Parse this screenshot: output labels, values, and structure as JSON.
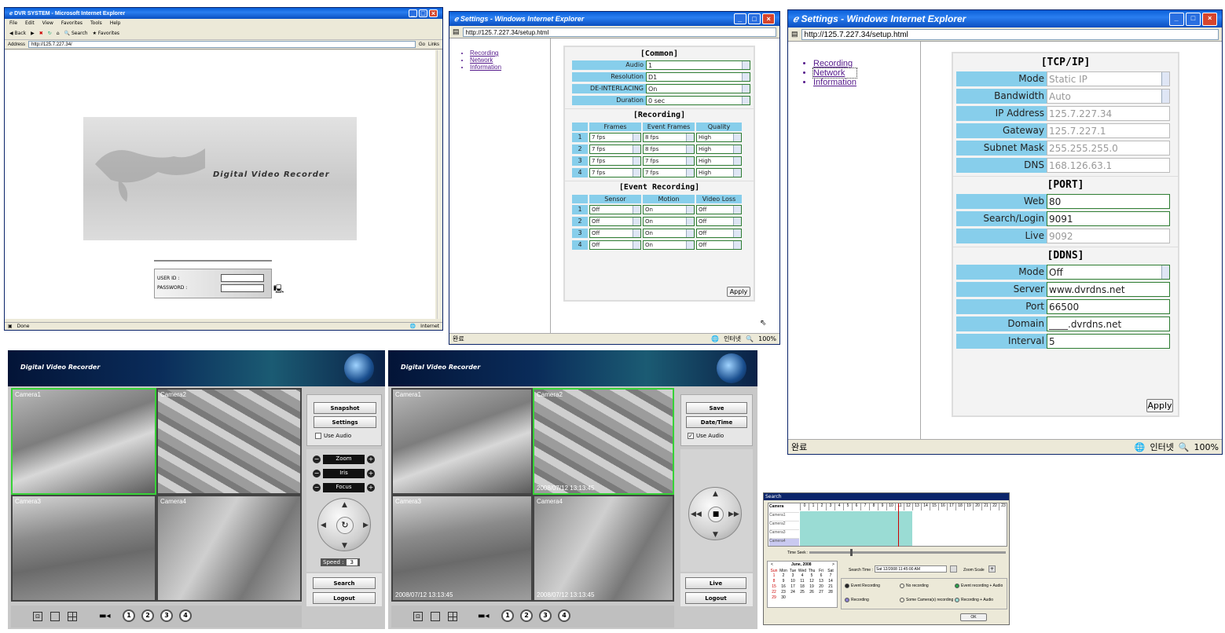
{
  "win1": {
    "title": "DVR SYSTEM - Microsoft Internet Explorer",
    "menu": [
      "File",
      "Edit",
      "View",
      "Favorites",
      "Tools",
      "Help"
    ],
    "toolbar": {
      "back": "Back",
      "search": "Search",
      "favorites": "Favorites"
    },
    "address_label": "Address",
    "url": "http://125.7.227.34/",
    "go": "Go",
    "links": "Links",
    "banner": "Digital Video Recorder",
    "user_id_label": "USER ID :",
    "password_label": "PASSWORD :",
    "status_left": "Done",
    "status_right": "Internet"
  },
  "win2": {
    "title": "Settings - Windows Internet Explorer",
    "url": "http://125.7.227.34/setup.html",
    "nav": [
      "Recording",
      "Network",
      "Information"
    ],
    "common_title": "[Common]",
    "common": [
      {
        "label": "Audio",
        "value": "1"
      },
      {
        "label": "Resolution",
        "value": "D1"
      },
      {
        "label": "DE-INTERLACING",
        "value": "On"
      },
      {
        "label": "Duration",
        "value": "0 sec"
      }
    ],
    "recording_title": "[Recording]",
    "rec_headers": [
      "Frames",
      "Event Frames",
      "Quality"
    ],
    "rec_rows": [
      {
        "n": "1",
        "frames": "7 fps",
        "event": "8 fps",
        "quality": "High"
      },
      {
        "n": "2",
        "frames": "7 fps",
        "event": "8 fps",
        "quality": "High"
      },
      {
        "n": "3",
        "frames": "7 fps",
        "event": "7 fps",
        "quality": "High"
      },
      {
        "n": "4",
        "frames": "7 fps",
        "event": "7 fps",
        "quality": "High"
      }
    ],
    "event_title": "[Event Recording]",
    "ev_headers": [
      "Sensor",
      "Motion",
      "Video Loss"
    ],
    "ev_rows": [
      {
        "n": "1",
        "sensor": "Off",
        "motion": "On",
        "loss": "Off"
      },
      {
        "n": "2",
        "sensor": "Off",
        "motion": "On",
        "loss": "Off"
      },
      {
        "n": "3",
        "sensor": "Off",
        "motion": "On",
        "loss": "Off"
      },
      {
        "n": "4",
        "sensor": "Off",
        "motion": "On",
        "loss": "Off"
      }
    ],
    "apply": "Apply",
    "status_left": "완료",
    "status_zone": "인터넷",
    "zoom": "100%"
  },
  "win3": {
    "title": "Settings - Windows Internet Explorer",
    "url": "http://125.7.227.34/setup.html",
    "nav": [
      "Recording",
      "Network",
      "Information"
    ],
    "tcp_title": "[TCP/IP]",
    "tcp": [
      {
        "label": "Mode",
        "value": "Static IP",
        "type": "select",
        "disabled": true
      },
      {
        "label": "Bandwidth",
        "value": "Auto",
        "type": "select",
        "disabled": true
      },
      {
        "label": "IP Address",
        "value": "125.7.227.34",
        "type": "text",
        "disabled": true
      },
      {
        "label": "Gateway",
        "value": "125.7.227.1",
        "type": "text",
        "disabled": true
      },
      {
        "label": "Subnet Mask",
        "value": "255.255.255.0",
        "type": "text",
        "disabled": true
      },
      {
        "label": "DNS",
        "value": "168.126.63.1",
        "type": "text",
        "disabled": true
      }
    ],
    "port_title": "[PORT]",
    "port": [
      {
        "label": "Web",
        "value": "80",
        "type": "text",
        "disabled": false
      },
      {
        "label": "Search/Login",
        "value": "9091",
        "type": "text",
        "disabled": false
      },
      {
        "label": "Live",
        "value": "9092",
        "type": "text",
        "disabled": true
      }
    ],
    "ddns_title": "[DDNS]",
    "ddns": [
      {
        "label": "Mode",
        "value": "Off",
        "type": "select",
        "disabled": false
      },
      {
        "label": "Server",
        "value": "www.dvrdns.net",
        "type": "text",
        "disabled": false
      },
      {
        "label": "Port",
        "value": "66500",
        "type": "text",
        "disabled": false
      },
      {
        "label": "Domain",
        "value": "____.dvrdns.net",
        "type": "text",
        "disabled": false
      },
      {
        "label": "Interval",
        "value": "5",
        "type": "text",
        "disabled": false
      }
    ],
    "apply": "Apply",
    "status_left": "완료",
    "status_zone": "인터넷",
    "zoom": "100%"
  },
  "dvr1": {
    "banner": "Digital Video Recorder",
    "cameras": [
      "Camera1",
      "Camera2",
      "Camera3",
      "Camera4"
    ],
    "snapshot": "Snapshot",
    "settings": "Settings",
    "use_audio": "Use Audio",
    "zoom": "Zoom",
    "iris": "Iris",
    "focus": "Focus",
    "speed_label": "Speed :",
    "speed_value": "3",
    "search": "Search",
    "logout": "Logout",
    "channel_buttons": [
      "1",
      "2",
      "3",
      "4"
    ]
  },
  "dvr2": {
    "banner": "Digital Video Recorder",
    "cameras": [
      "Camera1",
      "Camera2",
      "Camera3",
      "Camera4"
    ],
    "timestamps": [
      "2008/07/12 13:13:45",
      "2008/07/12 13:13:45",
      "2008/07/12 13:13:45"
    ],
    "save": "Save",
    "datetime": "Date/Time",
    "use_audio": "Use Audio",
    "live": "Live",
    "logout": "Logout",
    "channel_buttons": [
      "1",
      "2",
      "3",
      "4"
    ]
  },
  "search": {
    "title": "Search",
    "camera_header": "Camera",
    "cameras": [
      "Camera1",
      "Camera2",
      "Camera3",
      "Camera4"
    ],
    "hours": [
      "0",
      "1",
      "2",
      "3",
      "4",
      "5",
      "6",
      "7",
      "8",
      "9",
      "10",
      "11",
      "12",
      "13",
      "14",
      "15",
      "16",
      "17",
      "18",
      "19",
      "20",
      "21",
      "22",
      "23"
    ],
    "time_seek": "Time Seek :",
    "month": "June, 2008",
    "weekdays": [
      "Sun",
      "Mon",
      "Tue",
      "Wed",
      "Thu",
      "Fri",
      "Sat"
    ],
    "days": [
      "1",
      "2",
      "3",
      "4",
      "5",
      "6",
      "7",
      "8",
      "9",
      "10",
      "11",
      "12",
      "13",
      "14",
      "15",
      "16",
      "17",
      "18",
      "19",
      "20",
      "21",
      "22",
      "23",
      "24",
      "25",
      "26",
      "27",
      "28",
      "29",
      "30"
    ],
    "search_time_label": "Search Time :",
    "search_time_value": "Sat 12/2008 11:45:00 AM",
    "zoom_scale": "Zoom Scale",
    "legend": [
      "Event Recording",
      "No recording",
      "Event recording + Audio",
      "Recording",
      "Some Camera(s) recording",
      "Recording + Audio"
    ],
    "ok": "OK"
  },
  "colors": {
    "label_bg": "#87ceeb",
    "input_border": "#2e7d32",
    "selected_camera": "#37d237",
    "recorded_bar": "#9adcd4",
    "ie_title": "#0a5fd8"
  }
}
